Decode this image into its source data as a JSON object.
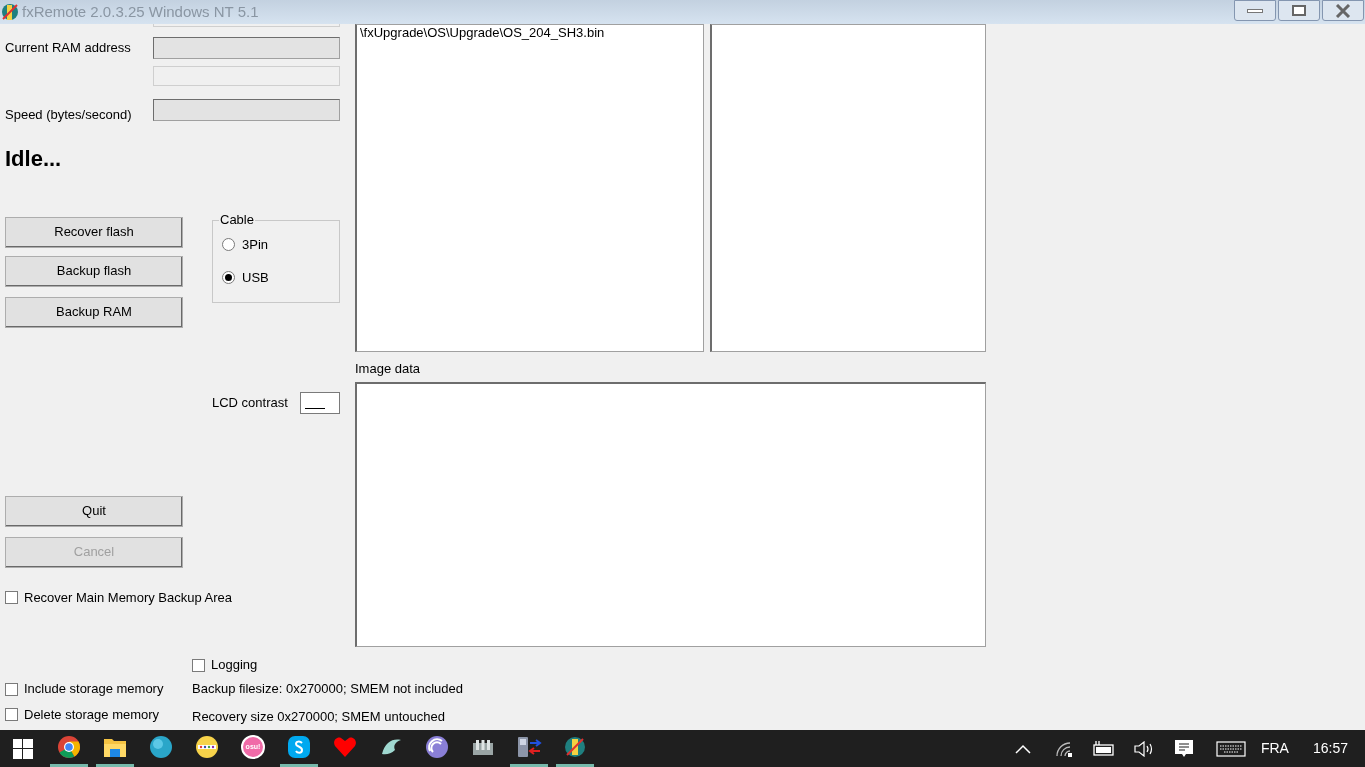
{
  "window": {
    "title": "fxRemote 2.0.3.25 Windows NT 5.1"
  },
  "fields": [
    {
      "label": "Current RAM address"
    },
    {
      "label": "Speed (bytes/second)"
    }
  ],
  "status": "Idle...",
  "buttons": [
    {
      "label": "Recover flash",
      "disabled": false
    },
    {
      "label": "Backup flash",
      "disabled": false
    },
    {
      "label": "Backup RAM",
      "disabled": false
    }
  ],
  "cable": {
    "title": "Cable",
    "options": [
      {
        "label": "3Pin",
        "selected": false
      },
      {
        "label": "USB",
        "selected": true
      }
    ]
  },
  "file_list": {
    "items": [
      "\\fxUpgrade\\OS\\Upgrade\\OS_204_SH3.bin"
    ]
  },
  "lcd_contrast": {
    "label": "LCD contrast"
  },
  "image_data": {
    "label": "Image data"
  },
  "actions": [
    {
      "label": "Quit",
      "disabled": false
    },
    {
      "label": "Cancel",
      "disabled": true
    }
  ],
  "recover_backup": {
    "label": "Recover Main Memory Backup Area",
    "checked": false
  },
  "logging": {
    "label": "Logging",
    "checked": false
  },
  "storage": [
    {
      "label": "Include storage memory",
      "checked": false,
      "info": "Backup filesize: 0x270000; SMEM not included"
    },
    {
      "label": "Delete storage memory",
      "checked": false,
      "info": "Recovery size 0x270000; SMEM untouched"
    }
  ],
  "taskbar": {
    "apps": [
      {
        "kind": "chrome",
        "running": true
      },
      {
        "kind": "folder",
        "running": true
      },
      {
        "kind": "ball",
        "running": false
      },
      {
        "kind": "dots",
        "running": false
      },
      {
        "kind": "osu",
        "label": "osu!",
        "running": false
      },
      {
        "kind": "skype",
        "running": true
      },
      {
        "kind": "heart",
        "running": false
      },
      {
        "kind": "bird",
        "running": false
      },
      {
        "kind": "torrent",
        "running": false
      },
      {
        "kind": "bars",
        "running": false
      },
      {
        "kind": "phone",
        "running": true
      },
      {
        "kind": "remote",
        "running": true
      }
    ],
    "language": "FRA",
    "time": "16:57"
  }
}
